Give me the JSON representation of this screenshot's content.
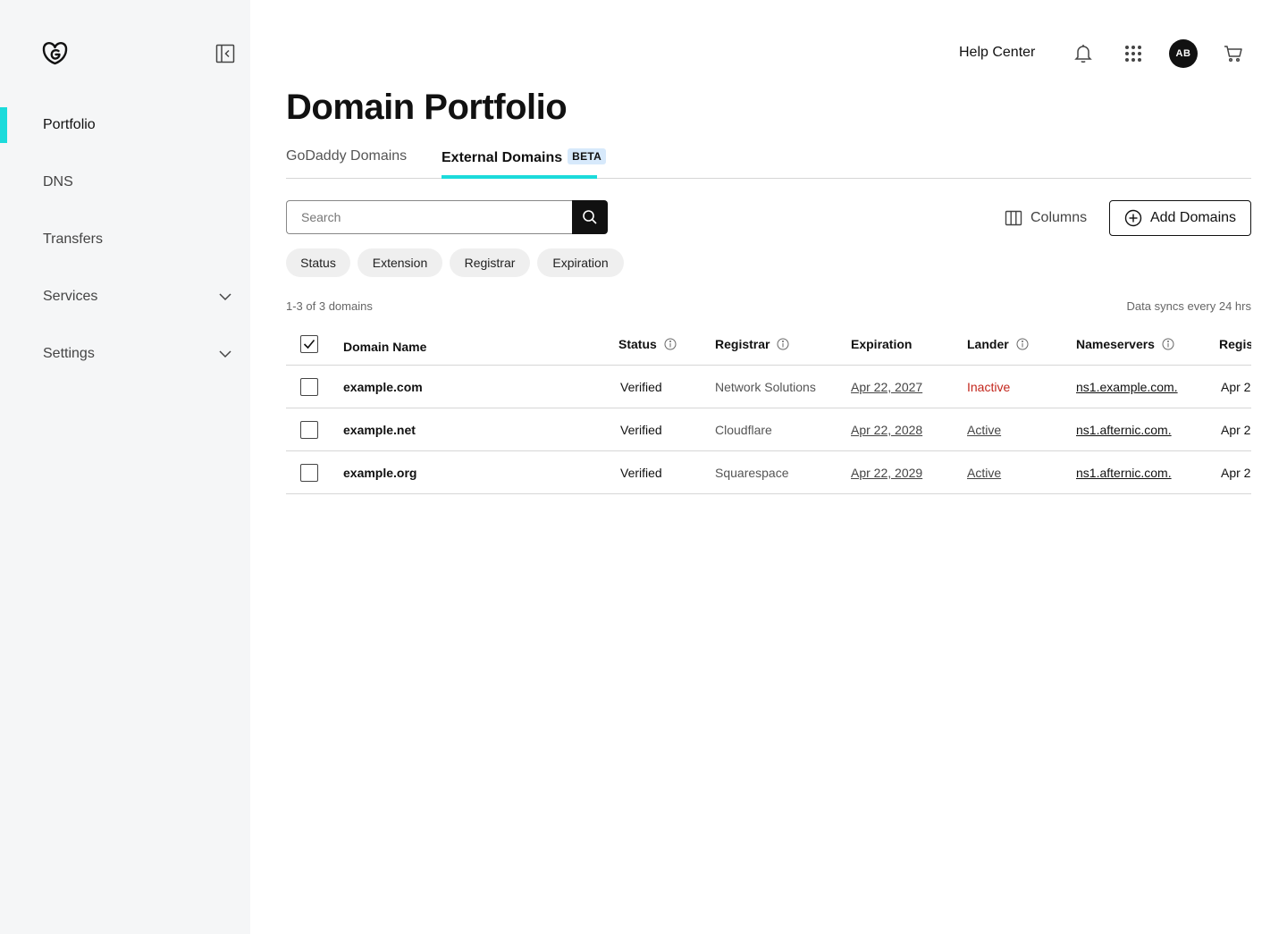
{
  "sidebar": {
    "items": [
      {
        "label": "Portfolio",
        "active": true
      },
      {
        "label": "DNS"
      },
      {
        "label": "Transfers"
      },
      {
        "label": "Services",
        "expandable": true
      },
      {
        "label": "Settings",
        "expandable": true
      }
    ]
  },
  "header": {
    "help_center": "Help Center",
    "avatar_initials": "AB",
    "icons": [
      "bell-icon",
      "apps-grid-icon",
      "cart-icon"
    ]
  },
  "page": {
    "title": "Domain Portfolio"
  },
  "tabs": [
    {
      "label": "GoDaddy Domains",
      "active": false
    },
    {
      "label": "External Domains",
      "badge": "BETA",
      "active": true
    }
  ],
  "search": {
    "placeholder": "Search",
    "value": ""
  },
  "toolbar": {
    "columns_label": "Columns",
    "add_domains_label": "Add Domains"
  },
  "filters": [
    "Status",
    "Extension",
    "Registrar",
    "Expiration"
  ],
  "summary": {
    "count": "1-3 of 3 domains",
    "sync": "Data syncs every 24 hrs"
  },
  "table": {
    "headers": {
      "domain_name": "Domain Name",
      "status": "Status",
      "registrar": "Registrar",
      "expiration": "Expiration",
      "lander": "Lander",
      "nameservers": "Nameservers",
      "registered": "Regist"
    },
    "rows": [
      {
        "domain": "example.com",
        "status": "Verified",
        "registrar": "Network Solutions",
        "expiration": "Apr 22, 2027",
        "lander": "Inactive",
        "nameservers": "ns1.example.com.",
        "registered": "Apr 2"
      },
      {
        "domain": "example.net",
        "status": "Verified",
        "registrar": "Cloudflare",
        "expiration": "Apr 22, 2028",
        "lander": "Active",
        "nameservers": "ns1.afternic.com.",
        "registered": "Apr 2"
      },
      {
        "domain": "example.org",
        "status": "Verified",
        "registrar": "Squarespace",
        "expiration": "Apr 22, 2029",
        "lander": "Active",
        "nameservers": "ns1.afternic.com.",
        "registered": "Apr 2"
      }
    ]
  },
  "colors": {
    "accent": "#1bdbdb",
    "inactive": "#c3261c",
    "sidebar_bg": "#f5f6f7",
    "beta_bg": "#d7e9fb"
  }
}
